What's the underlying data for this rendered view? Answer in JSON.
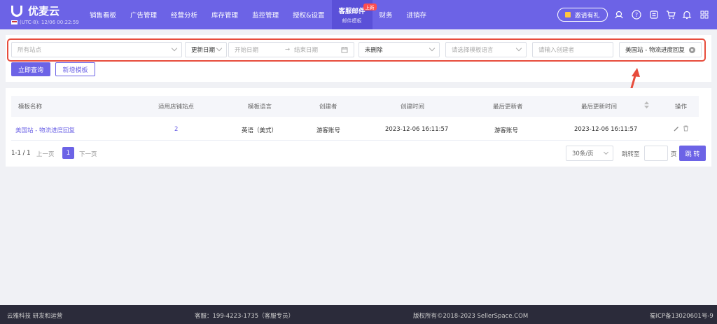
{
  "brand": {
    "name": "优麦云",
    "timezone": "(UTC-8): 12/06 00:22:59"
  },
  "nav": [
    {
      "label": "销售看板"
    },
    {
      "label": "广告管理"
    },
    {
      "label": "经营分析"
    },
    {
      "label": "库存管理"
    },
    {
      "label": "监控管理"
    },
    {
      "label": "授权&设置"
    },
    {
      "label": "客服邮件",
      "sub": "邮件模板",
      "badge": "上新",
      "active": true
    },
    {
      "label": "财务"
    },
    {
      "label": "进销存"
    }
  ],
  "header": {
    "invite_label": "邀请有礼"
  },
  "icons": {
    "headset": "headset-icon",
    "help": "help-icon",
    "doc": "document-icon",
    "cart": "cart-icon",
    "bell": "bell-icon",
    "more": "more-icon"
  },
  "filters": {
    "site_placeholder": "所有站点",
    "date_type": "更新日期",
    "start_placeholder": "开始日期",
    "range_sep": "→",
    "end_placeholder": "结束日期",
    "delete_status": "未删除",
    "language_placeholder": "请选择模板语言",
    "creator_placeholder": "请输入创建者",
    "template_name_value": "美国站 - 物流进度回复"
  },
  "actions": {
    "query_label": "立即查询",
    "add_label": "新增模板"
  },
  "table": {
    "columns": [
      "模板名称",
      "适用店铺站点",
      "模板语言",
      "创建者",
      "创建时间",
      "最后更新者",
      "最后更新时间",
      "操作"
    ],
    "rows": [
      {
        "name": "美国站 - 物流进度回复",
        "sites": "2",
        "language": "英语（美式）",
        "creator": "游客账号",
        "created": "2023-12-06 16:11:57",
        "updater": "游客账号",
        "updated": "2023-12-06 16:11:57"
      }
    ]
  },
  "pagination": {
    "range": "1-1 / 1",
    "prev": "上一页",
    "current": "1",
    "next": "下一页",
    "page_size": "30条/页",
    "jump_label": "跳转至",
    "page_unit": "页",
    "jump_button": "跳 转"
  },
  "footer": {
    "left": "云雅科技 研发和运营",
    "service": "客服：199-4223-1735（客服专员）",
    "copyright": "版权所有©2018-2023 SellerSpace.COM",
    "icp": "蜀ICP备13020601号-9"
  },
  "colors": {
    "primary": "#6c63e6",
    "highlight_border": "#e74c3c",
    "footer_bg": "#2b2b3a"
  }
}
